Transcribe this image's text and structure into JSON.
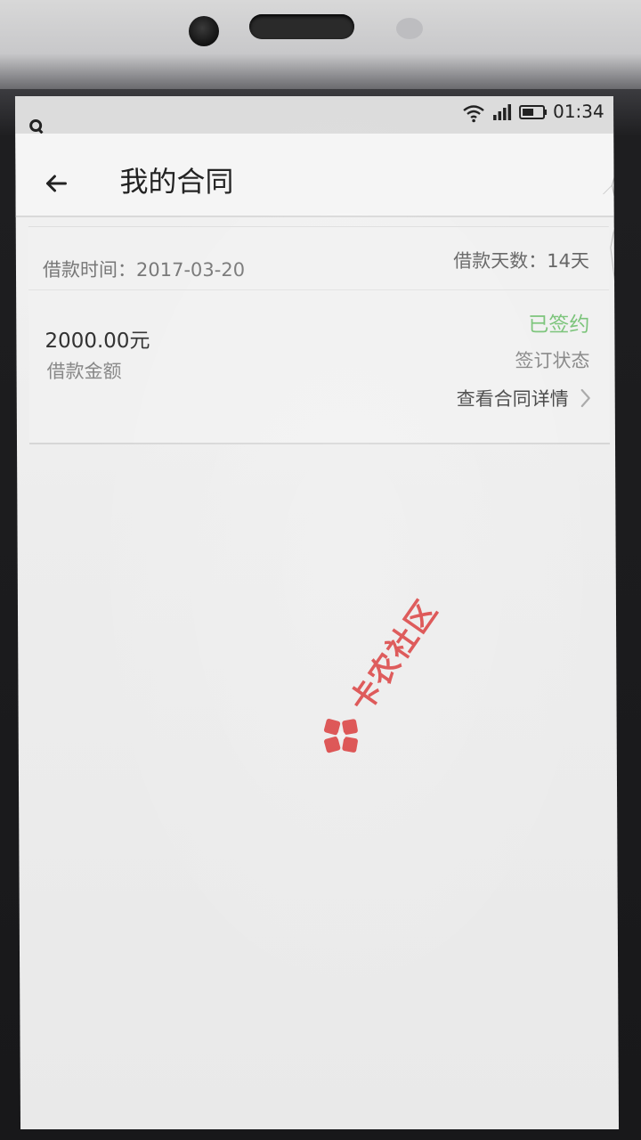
{
  "status_bar": {
    "time": "01:34",
    "icons": [
      "app-notification-icon",
      "wifi-icon",
      "signal-icon",
      "battery-icon"
    ]
  },
  "nav": {
    "back_icon": "arrow-left-icon",
    "title": "我的合同"
  },
  "contract": {
    "loan_time_label": "借款时间：",
    "loan_time_value": "2017-03-20",
    "loan_days_label": "借款天数：",
    "loan_days_value": "14天",
    "amount_value": "2000.00元",
    "amount_label": "借款金额",
    "status_value": "已签约",
    "status_label": "签订状态",
    "details_link": "查看合同详情"
  },
  "watermark": {
    "text": "卡农社区"
  },
  "colors": {
    "status_signed": "#7bc47a",
    "watermark_red": "#d93a3a"
  }
}
